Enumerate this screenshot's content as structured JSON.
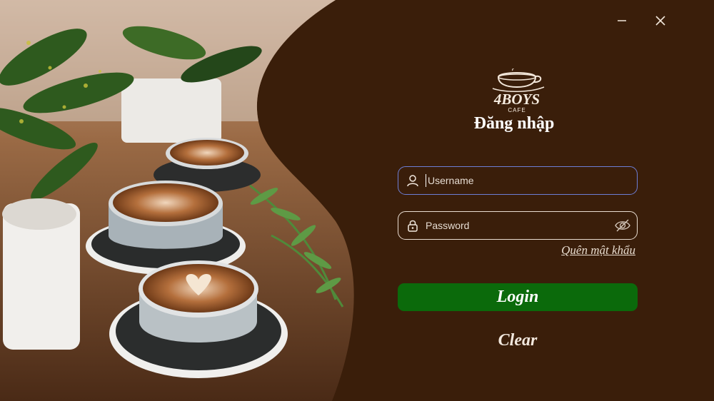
{
  "window": {
    "minimize_icon": "minimize-icon",
    "close_icon": "close-icon"
  },
  "brand": {
    "logo_text": "4BOYS",
    "logo_sub": "CAFE"
  },
  "login_form": {
    "title": "Đăng nhập",
    "username_placeholder": "Username",
    "password_placeholder": "Password",
    "forgot_password": "Quên mật khẩu",
    "login_label": "Login",
    "clear_label": "Clear"
  },
  "colors": {
    "background": "#3a1e0a",
    "login_button": "#0b6a0b",
    "username_focus_border": "#6d7ed6"
  }
}
